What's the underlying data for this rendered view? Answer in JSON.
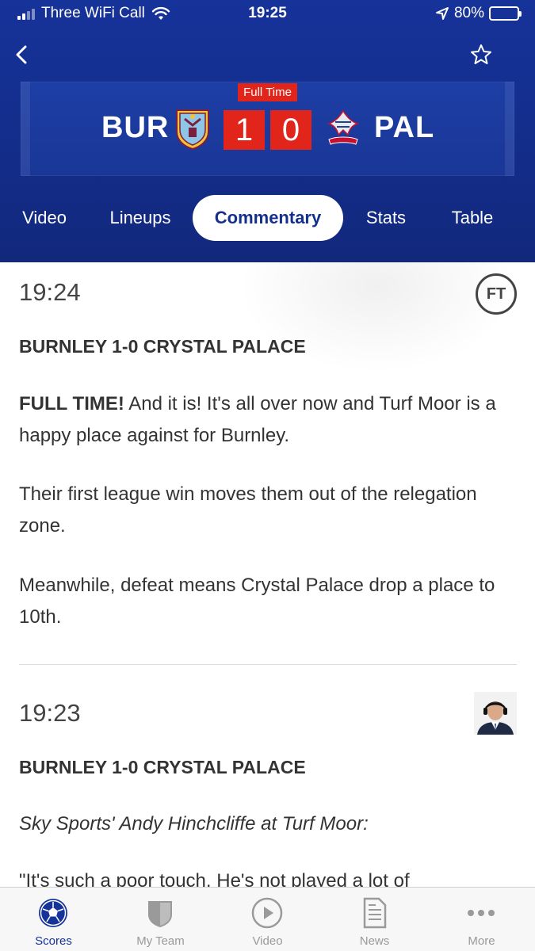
{
  "status_bar": {
    "carrier": "Three WiFi Call",
    "time": "19:25",
    "battery": "80%",
    "battery_level": 0.8
  },
  "match": {
    "status": "Full Time",
    "home": {
      "code": "BUR",
      "score": "1"
    },
    "away": {
      "code": "PAL",
      "score": "0"
    }
  },
  "tabs": [
    {
      "label": "Video",
      "active": false
    },
    {
      "label": "Lineups",
      "active": false
    },
    {
      "label": "Commentary",
      "active": true
    },
    {
      "label": "Stats",
      "active": false
    },
    {
      "label": "Table",
      "active": false
    }
  ],
  "commentary": [
    {
      "time": "19:24",
      "badge": "FT",
      "title": "BURNLEY 1-0 CRYSTAL PALACE",
      "p1_bold": "FULL TIME!",
      "p1_text": " And it is! It's all over now and Turf Moor is a happy place against for Burnley.",
      "p2": "Their first league win moves them out of the relegation zone.",
      "p3": "Meanwhile, defeat means Crystal Palace drop a place to 10th."
    },
    {
      "time": "19:23",
      "title": "BURNLEY 1-0 CRYSTAL PALACE",
      "p1": "Sky Sports' Andy Hinchcliffe at Turf Moor:",
      "p2": "\"It's such a poor touch. He's not played a lot of"
    }
  ],
  "bottom_nav": [
    {
      "label": "Scores",
      "icon": "football-icon",
      "active": true
    },
    {
      "label": "My Team",
      "icon": "shield-icon",
      "active": false
    },
    {
      "label": "Video",
      "icon": "play-icon",
      "active": false
    },
    {
      "label": "News",
      "icon": "document-icon",
      "active": false
    },
    {
      "label": "More",
      "icon": "more-dots-icon",
      "active": false
    }
  ],
  "colors": {
    "header": "#16339a",
    "score_red": "#e1251b",
    "active_tab_text": "#142f8e"
  }
}
